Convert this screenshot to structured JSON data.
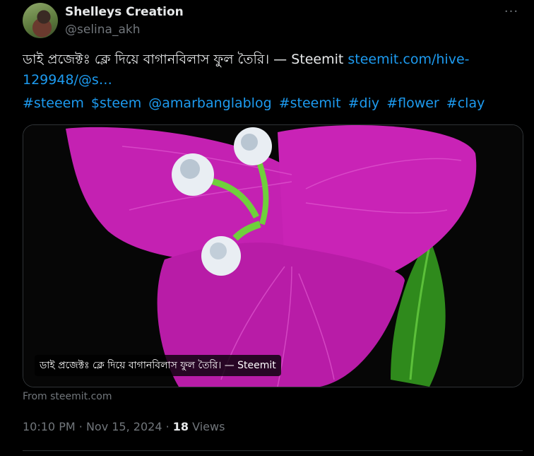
{
  "author": {
    "name": "Shelleys Creation",
    "handle": "@selina_akh"
  },
  "more_icon": "more-horizontal-icon",
  "tweet": {
    "text": "ডাই প্রজেক্টঃ ক্লে দিয়ে বাগানবিলাস ফুল তৈরি। — Steemit ",
    "link": "steemit.com/hive-129948/@s…"
  },
  "hashtags": [
    "#steeem",
    "$steem",
    "@amarbanglablog",
    "#steemit",
    "#diy",
    "#flower",
    "#clay"
  ],
  "card": {
    "caption": "ডাই প্রজেক্টঃ ক্লে দিয়ে বাগানবিলাস ফুল তৈরি। — Steemit",
    "source": "From steemit.com"
  },
  "meta": {
    "time": "10:10 PM",
    "separator": "·",
    "date": "Nov 15, 2024",
    "views_count": "18",
    "views_label": "Views"
  },
  "colors": {
    "accent": "#1d9bf0",
    "muted": "#71767b",
    "text": "#e7e9ea",
    "petal": "#c81fb5"
  }
}
